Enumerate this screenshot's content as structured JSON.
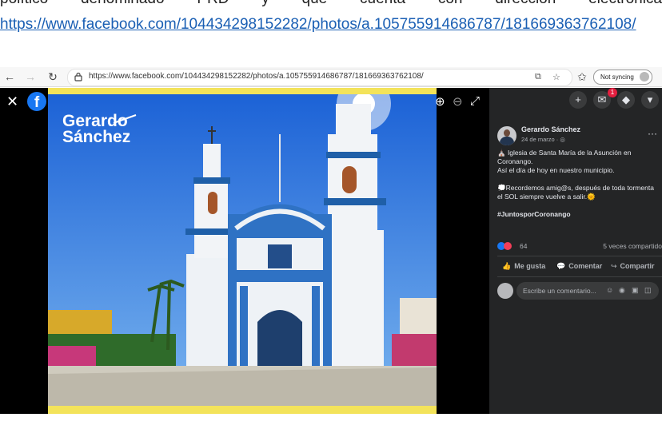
{
  "document": {
    "line1_words": [
      "político",
      "denominado",
      "PRD",
      "y",
      "que",
      "cuenta",
      "con",
      "dirección",
      "electrónica"
    ],
    "link": "https://www.facebook.com/104434298152282/photos/a.105755914686787/181669363762108/"
  },
  "browser": {
    "url": "https://www.facebook.com/104434298152282/photos/a.105755914686787/181669363762108/",
    "sync_label": "Not syncing"
  },
  "photo": {
    "overlay_line1": "Gerardo",
    "overlay_line2": "Sánchez"
  },
  "post": {
    "author": "Gerardo Sánchez",
    "date": "24 de marzo · ",
    "lines": [
      "⛪ Iglesia de Santa María de la Asunción en Coronango.",
      "Así el día de hoy en nuestro municipio.",
      "",
      "💭Recordemos amig@s, después de toda tormenta el SOL siempre vuelve a salir.🌞",
      "",
      "#JuntosporCoronango"
    ],
    "reaction_count": "64",
    "shares": "5 veces compartido",
    "like_label": "Me gusta",
    "comment_label": "Comentar",
    "share_label": "Compartir",
    "comment_placeholder": "Escribe un comentario..."
  },
  "notifications": {
    "messenger_badge": "1"
  },
  "colors": {
    "facebook_blue": "#1877f2",
    "panel_bg": "#242526",
    "photo_frame": "#f3e35a",
    "church_blue": "#1f5fa8"
  }
}
